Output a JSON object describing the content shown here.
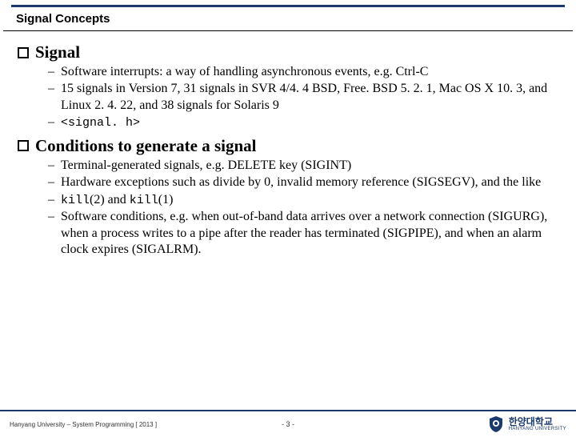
{
  "section_title": "Signal Concepts",
  "headings": {
    "signal": "Signal",
    "conditions": "Conditions to generate a signal"
  },
  "signal_items": [
    "Software interrupts: a way of handling asynchronous events, e.g. Ctrl-C",
    "15 signals in Version 7, 31 signals in SVR 4/4. 4 BSD, Free. BSD 5. 2. 1, Mac OS X 10. 3, and Linux 2. 4. 22, and 38 signals for Solaris 9"
  ],
  "signal_code_item": "<signal. h>",
  "conditions_items": [
    "Terminal-generated signals, e.g. DELETE key (SIGINT)",
    "Hardware exceptions such as divide by 0, invalid memory reference (SIGSEGV), and the like",
    "Software conditions, e.g. when out-of-band data arrives over a network connection (SIGURG), when a process writes to a pipe after the reader has terminated (SIGPIPE), and when an alarm clock expires (SIGALRM)."
  ],
  "conditions_kill_item": {
    "prefix": "kill",
    "mid1": "(2) and ",
    "suffix": "kill",
    "mid2": "(1)"
  },
  "footer": {
    "left": "Hanyang University – System Programming [ 2013 ]",
    "page": "- 3 -",
    "logo_kr": "한양대학교",
    "logo_en": "HANYANG UNIVERSITY"
  }
}
